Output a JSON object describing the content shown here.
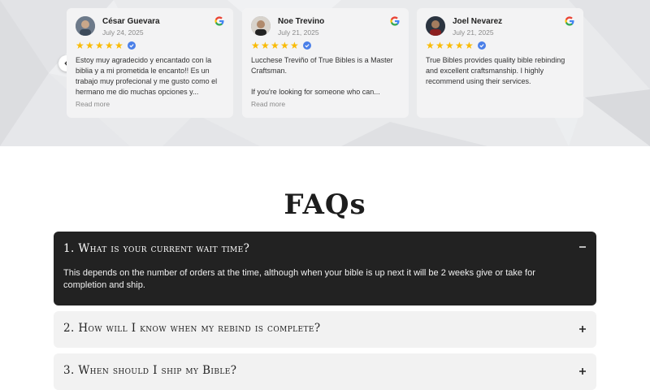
{
  "reviews": [
    {
      "name": "César Guevara",
      "date": "July 24, 2025",
      "stars": 5,
      "text": "Estoy muy agradecido y encantado con la biblia y a mi prometida le encanto!! Es un trabajo muy profecional y me gusto como el hermano me dio muchas opciones y...",
      "read_more": "Read more"
    },
    {
      "name": "Noe Trevino",
      "date": "July 21, 2025",
      "stars": 5,
      "text": "Lucchese Treviño of True Bibles is a Master Craftsman.\n\nIf you're looking for someone who can...",
      "read_more": "Read more"
    },
    {
      "name": "Joel Nevarez",
      "date": "July 21, 2025",
      "stars": 5,
      "text": "True Bibles provides quality bible rebinding and excellent craftsmanship. I highly recommend using their services.",
      "read_more": ""
    }
  ],
  "colors": {
    "star": "#f9bb06",
    "verified": "#4a7fe8",
    "faq_open_bg": "#222222",
    "faq_closed_bg": "#f2f2f2"
  },
  "faq": {
    "title": "FAQs",
    "items": [
      {
        "question": "1. What is your current wait time?",
        "answer": "This depends on the number of orders at the time, although when your bible is up next it will be 2 weeks give or take for completion and ship.",
        "open": true,
        "toggle_icon": "minus-icon"
      },
      {
        "question": "2. How will I know when my rebind is complete?",
        "answer": "",
        "open": false,
        "toggle_icon": "plus-icon"
      },
      {
        "question": "3. When should I ship my Bible?",
        "answer": "",
        "open": false,
        "toggle_icon": "plus-icon"
      }
    ]
  }
}
